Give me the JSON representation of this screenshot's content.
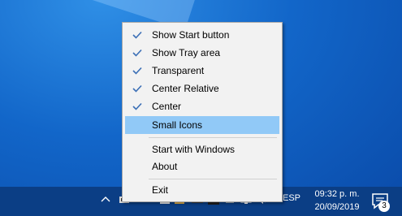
{
  "menu": {
    "items": [
      {
        "label": "Show Start button",
        "checked": true
      },
      {
        "label": "Show Tray area",
        "checked": true
      },
      {
        "label": "Transparent",
        "checked": true
      },
      {
        "label": "Center Relative",
        "checked": true
      },
      {
        "label": "Center",
        "checked": true
      },
      {
        "label": "Small Icons",
        "checked": false,
        "highlighted": true
      },
      {
        "label": "Start with Windows",
        "checked": false
      },
      {
        "label": "About",
        "checked": false
      },
      {
        "label": "Exit",
        "checked": false
      }
    ]
  },
  "taskbar": {
    "language": "ESP",
    "time": "09:32 p. m.",
    "date": "20/09/2019",
    "notification_count": "3"
  },
  "colors": {
    "highlight": "#91c9f7",
    "check": "#3b6fb6",
    "taskbar": "#0b3e85"
  }
}
